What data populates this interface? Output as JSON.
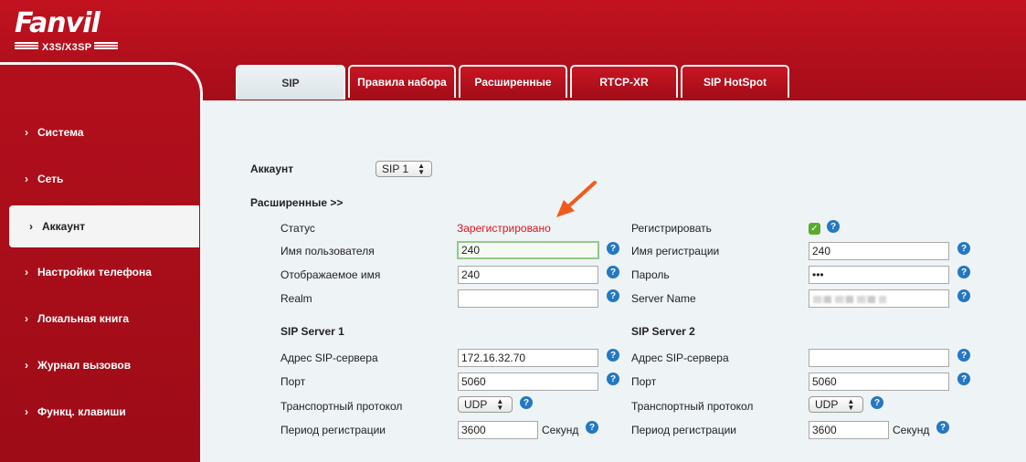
{
  "brand": {
    "name": "Fanvil",
    "model": "X3S/X3SP"
  },
  "colors": {
    "accent_red": "#b30f1c",
    "status_red": "#e1141d",
    "help_blue": "#2478c2",
    "check_green": "#5aab2b"
  },
  "sidebar": {
    "items": [
      {
        "label": "Система",
        "icon": "chevron-right-icon"
      },
      {
        "label": "Сеть",
        "icon": "chevron-right-icon"
      },
      {
        "label": "Аккаунт",
        "icon": "chevron-right-icon",
        "active": true
      },
      {
        "label": "Настройки телефона",
        "icon": "chevron-right-icon"
      },
      {
        "label": "Локальная книга",
        "icon": "chevron-right-icon"
      },
      {
        "label": "Журнал вызовов",
        "icon": "chevron-right-icon"
      },
      {
        "label": "Функц. клавиши",
        "icon": "chevron-right-icon"
      }
    ]
  },
  "tabs": [
    {
      "label": "SIP",
      "active": true
    },
    {
      "label": "Правила набора"
    },
    {
      "label": "Расширенные"
    },
    {
      "label": "RTCP-XR"
    },
    {
      "label": "SIP HotSpot"
    }
  ],
  "account": {
    "label": "Аккаунт",
    "selected": "SIP 1"
  },
  "advanced_link": "Расширенные >>",
  "left": {
    "status_label": "Статус",
    "status_value": "Зарегистрировано",
    "username_label": "Имя пользователя",
    "username_value": "240",
    "display_label": "Отображаемое имя",
    "display_value": "240",
    "realm_label": "Realm",
    "realm_value": ""
  },
  "right": {
    "register_label": "Регистрировать",
    "register_checked": true,
    "authname_label": "Имя регистрации",
    "authname_value": "240",
    "password_label": "Пароль",
    "password_value": "•••",
    "servername_label": "Server Name"
  },
  "server1": {
    "title": "SIP Server 1",
    "addr_label": "Адрес SIP-сервера",
    "addr_value": "172.16.32.70",
    "port_label": "Порт",
    "port_value": "5060",
    "transport_label": "Транспортный протокол",
    "transport_value": "UDP",
    "period_label": "Период регистрации",
    "period_value": "3600",
    "period_unit": "Секунд"
  },
  "server2": {
    "title": "SIP Server 2",
    "addr_label": "Адрес SIP-сервера",
    "addr_value": "",
    "port_label": "Порт",
    "port_value": "5060",
    "transport_label": "Транспортный протокол",
    "transport_value": "UDP",
    "period_label": "Период регистрации",
    "period_value": "3600",
    "period_unit": "Секунд"
  },
  "help_glyph": "?",
  "check_glyph": "✓"
}
